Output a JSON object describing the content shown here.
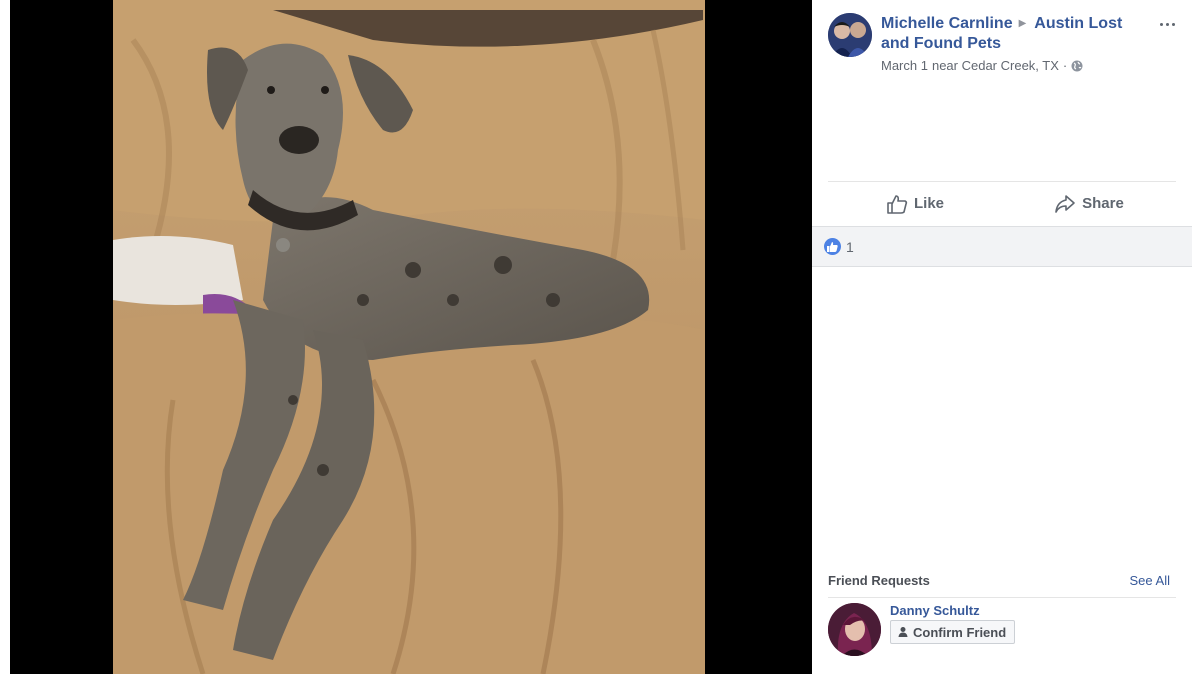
{
  "photo": {
    "alt": "Great Dane dog lying on a tan couch cover",
    "icon": "photo"
  },
  "post": {
    "author": "Michelle Carnline",
    "group": "Austin Lost and Found Pets",
    "date": "March 1",
    "location": "near Cedar Creek, TX",
    "separator": "·",
    "privacy_icon": "globe-icon"
  },
  "actions": {
    "like_label": "Like",
    "share_label": "Share"
  },
  "reactions": {
    "count": "1",
    "type_icon": "like-reaction-icon"
  },
  "friend_requests": {
    "title": "Friend Requests",
    "see_all": "See All",
    "items": [
      {
        "name": "Danny Schultz",
        "confirm_label": "Confirm Friend"
      }
    ]
  },
  "colors": {
    "link_blue": "#365899",
    "reaction_blue": "#4d82e4",
    "meta_gray": "#616770"
  }
}
